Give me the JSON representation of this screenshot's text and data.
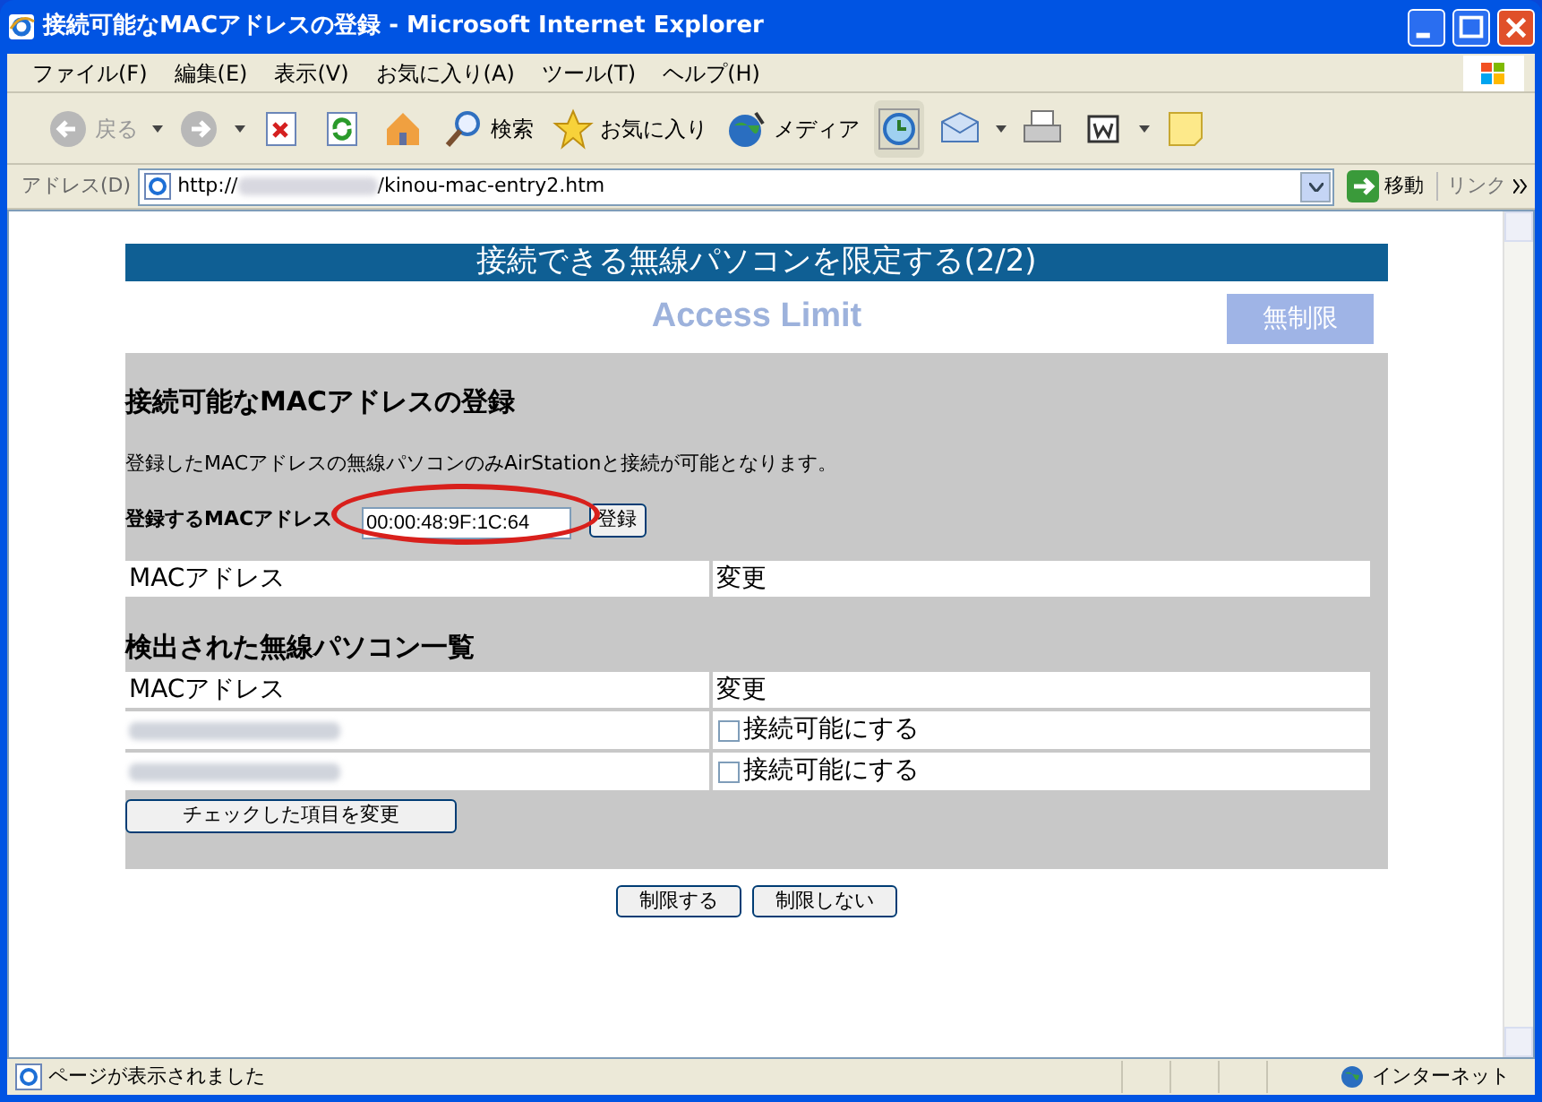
{
  "window": {
    "title": "接続可能なMACアドレスの登録 - Microsoft Internet Explorer"
  },
  "menu": [
    "ファイル(F)",
    "編集(E)",
    "表示(V)",
    "お気に入り(A)",
    "ツール(T)",
    "ヘルプ(H)"
  ],
  "toolbar": [
    {
      "kind": "back",
      "label": "戻る"
    },
    {
      "kind": "forward"
    },
    {
      "kind": "stop"
    },
    {
      "kind": "refresh"
    },
    {
      "kind": "home"
    },
    {
      "kind": "search",
      "label": "検索"
    },
    {
      "kind": "favorites",
      "label": "お気に入り"
    },
    {
      "kind": "media",
      "label": "メディア"
    },
    {
      "kind": "history"
    },
    {
      "kind": "mail"
    },
    {
      "kind": "print"
    },
    {
      "kind": "word"
    },
    {
      "kind": "note"
    }
  ],
  "address_bar": {
    "label": "アドレス(D)",
    "url_start": "http://",
    "url_end": "/kinou-mac-entry2.htm",
    "go": "移動",
    "links": "リンク"
  },
  "page": {
    "banner": "接続できる無線パソコンを限定する(2/2)",
    "title": "Access Limit",
    "mode_button": "無制限",
    "heading": "接続可能なMACアドレスの登録",
    "description": "登録したMACアドレスの無線パソコンのみAirStationと接続が可能となります。",
    "mac_label": "登録するMACアドレス",
    "mac_input": "00:00:48:9F:1C:64",
    "register_button": "登録",
    "registered_columns": [
      "MACアドレス",
      "変更"
    ],
    "detected_heading": "検出された無線パソコン一覧",
    "detected_columns": [
      "MACアドレス",
      "変更"
    ],
    "detected_rows": [
      {
        "action": "接続可能にする",
        "checked": false
      },
      {
        "action": "接続可能にする",
        "checked": false
      }
    ],
    "apply_button": "チェックした項目を変更",
    "buttons": [
      "制限する",
      "制限しない"
    ]
  },
  "status_bar": {
    "text": "ページが表示されました",
    "zone": "インターネット"
  }
}
